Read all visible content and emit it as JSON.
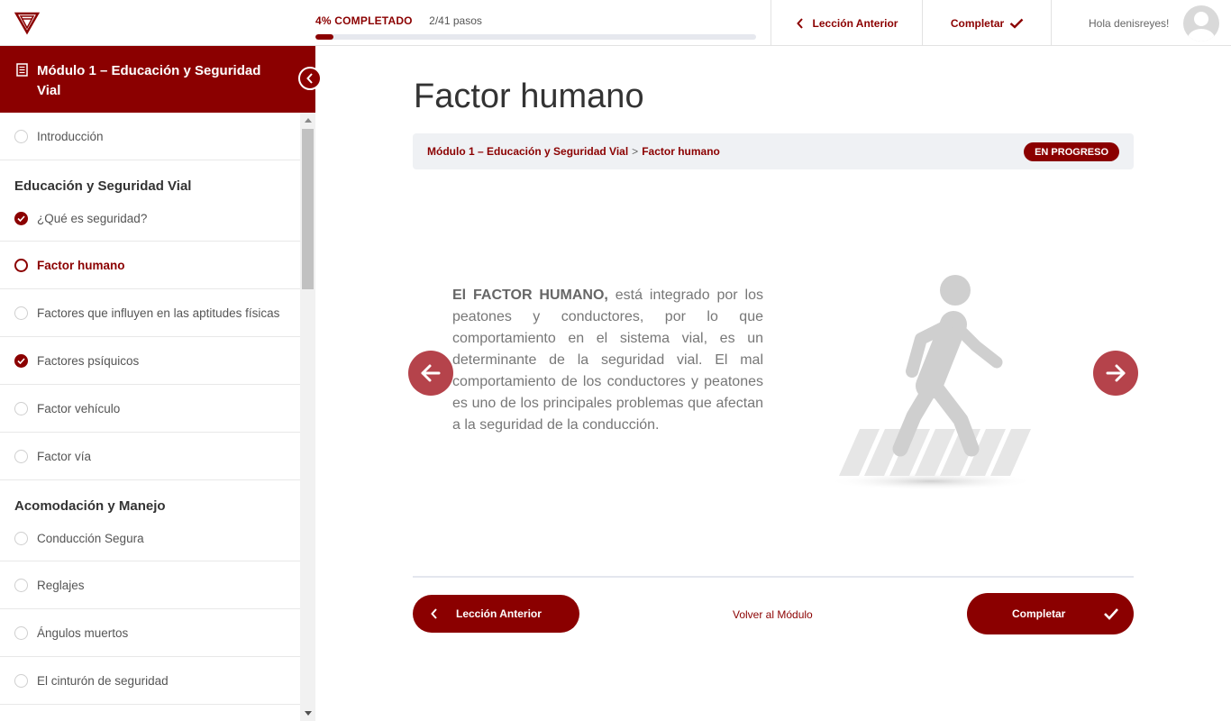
{
  "header": {
    "progress_percent_label": "4% COMPLETADO",
    "progress_fraction": 0.04,
    "steps_label": "2/41 pasos",
    "prev_label": "Lección Anterior",
    "complete_label": "Completar",
    "greeting": "Hola denisreyes!"
  },
  "sidebar": {
    "module_title": "Módulo 1 – Educación y Seguridad Vial",
    "items": [
      {
        "type": "item",
        "label": "Introducción",
        "state": "pending"
      },
      {
        "type": "section",
        "label": "Educación y Seguridad Vial"
      },
      {
        "type": "item",
        "label": "¿Qué es seguridad?",
        "state": "done"
      },
      {
        "type": "item",
        "label": "Factor humano",
        "state": "current"
      },
      {
        "type": "item",
        "label": "Factores que influyen en las aptitudes físicas",
        "state": "pending"
      },
      {
        "type": "item",
        "label": "Factores psíquicos",
        "state": "done"
      },
      {
        "type": "item",
        "label": "Factor vehículo",
        "state": "pending"
      },
      {
        "type": "item",
        "label": "Factor vía",
        "state": "pending"
      },
      {
        "type": "section",
        "label": "Acomodación y Manejo"
      },
      {
        "type": "item",
        "label": "Conducción Segura",
        "state": "pending"
      },
      {
        "type": "item",
        "label": "Reglajes",
        "state": "pending"
      },
      {
        "type": "item",
        "label": "Ángulos muertos",
        "state": "pending"
      },
      {
        "type": "item",
        "label": "El cinturón de seguridad",
        "state": "pending"
      }
    ]
  },
  "main": {
    "title": "Factor humano",
    "breadcrumb_module": "Módulo 1 – Educación y Seguridad Vial",
    "breadcrumb_separator": ">",
    "breadcrumb_lesson": "Factor humano",
    "status": "EN PROGRESO",
    "text_strong": "El FACTOR HUMANO,",
    "text_rest": " está integrado por los peatones y conductores, por lo que comportamiento en el sistema vial, es un determinante de la seguridad vial. El mal comportamiento de los conductores y peatones es uno de los principales problemas que afectan a la seguridad de la conducción.",
    "prev_button": "Lección Anterior",
    "back_link": "Volver al Módulo",
    "complete_button": "Completar"
  },
  "colors": {
    "brand": "#8b0000",
    "slide_arrow": "#b5434b"
  }
}
